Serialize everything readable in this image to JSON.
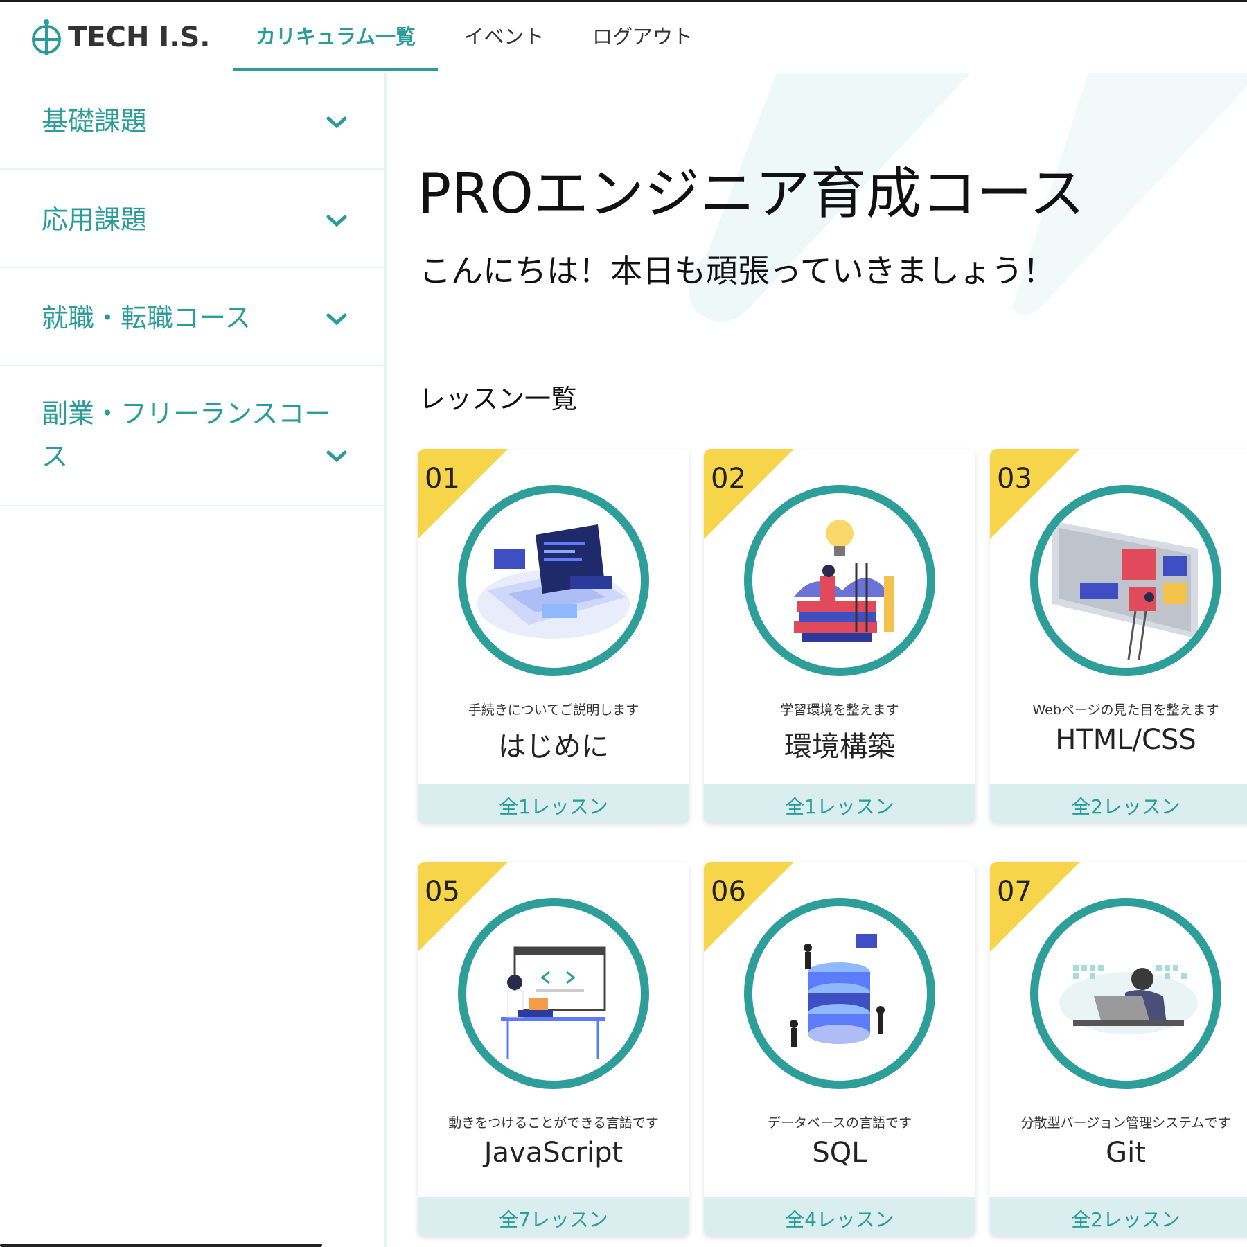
{
  "header": {
    "logo_text": "TECH I.S.",
    "nav": [
      {
        "label": "カリキュラム一覧",
        "active": true
      },
      {
        "label": "イベント",
        "active": false
      },
      {
        "label": "ログアウト",
        "active": false
      }
    ]
  },
  "sidebar": {
    "items": [
      {
        "label": "基礎課題"
      },
      {
        "label": "応用課題"
      },
      {
        "label": "就職・転職コース"
      },
      {
        "label_line1": "副業・フリーランスコー",
        "label_line2": "ス"
      }
    ]
  },
  "main": {
    "course_title": "PROエンジニア育成コース",
    "greeting": "こんにちは！本日も頑張っていきましょう！",
    "section_title": "レッスン一覧",
    "lessons": [
      {
        "number": "01",
        "description": "手続きについてご説明します",
        "name": "はじめに",
        "count": "全1レッスン"
      },
      {
        "number": "02",
        "description": "学習環境を整えます",
        "name": "環境構築",
        "count": "全1レッスン"
      },
      {
        "number": "03",
        "description": "Webページの見た目を整えます",
        "name": "HTML/CSS",
        "count": "全2レッスン"
      },
      {
        "number": "05",
        "description": "動きをつけることができる言語です",
        "name": "JavaScript",
        "count": "全7レッスン"
      },
      {
        "number": "06",
        "description": "データベースの言語です",
        "name": "SQL",
        "count": "全4レッスン"
      },
      {
        "number": "07",
        "description": "分散型バージョン管理システムです",
        "name": "Git",
        "count": "全2レッスン"
      }
    ]
  },
  "colors": {
    "accent": "#2a9d9a",
    "ribbon": "#f7d54a",
    "count_bg": "#daeef0"
  }
}
